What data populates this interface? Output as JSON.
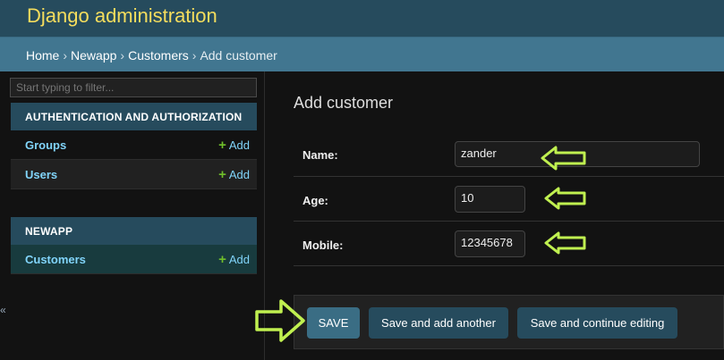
{
  "header": {
    "title": "Django administration"
  },
  "breadcrumbs": {
    "home": "Home",
    "sep": "›",
    "app": "Newapp",
    "model": "Customers",
    "current": "Add customer"
  },
  "sidebar": {
    "filter_placeholder": "Start typing to filter...",
    "modules": [
      {
        "caption": "AUTHENTICATION AND AUTHORIZATION",
        "items": [
          {
            "name": "Groups",
            "add": "Add"
          },
          {
            "name": "Users",
            "add": "Add"
          }
        ]
      },
      {
        "caption": "NEWAPP",
        "items": [
          {
            "name": "Customers",
            "add": "Add"
          }
        ]
      }
    ],
    "plus": "+",
    "collapse": "«"
  },
  "form": {
    "title": "Add customer",
    "fields": [
      {
        "label": "Name:",
        "value": "zander"
      },
      {
        "label": "Age:",
        "value": "10"
      },
      {
        "label": "Mobile:",
        "value": "12345678"
      }
    ]
  },
  "buttons": {
    "save": "SAVE",
    "save_add": "Save and add another",
    "save_continue": "Save and continue editing"
  },
  "colors": {
    "header": "#264b5d",
    "breadcrumbs": "#417690",
    "brand_text": "#f5dd5d",
    "link": "#81d4fa",
    "annotation_arrow": "#c0f050"
  },
  "icons": {
    "annotation": "arrow-left-icon",
    "annotation_save": "arrow-right-icon",
    "add": "plus-icon"
  }
}
